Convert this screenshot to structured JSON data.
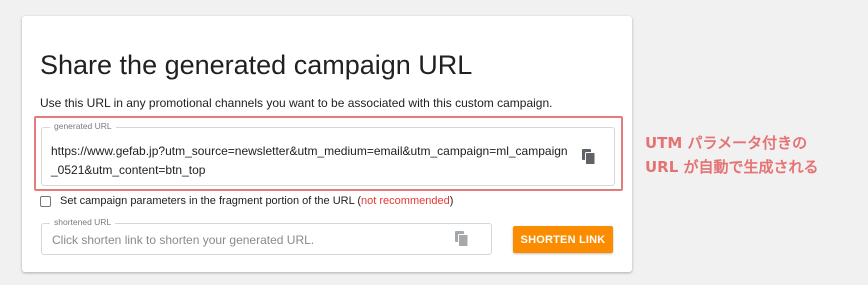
{
  "card": {
    "title": "Share the generated campaign URL",
    "description": "Use this URL in any promotional channels you want to be associated with this custom campaign."
  },
  "generated_url": {
    "label": "generated URL",
    "value": "https://www.gefab.jp?utm_source=newsletter&utm_medium=email&utm_campaign=ml_campaign_0521&utm_content=btn_top",
    "copy_icon": "copy-icon"
  },
  "fragment_option": {
    "checked": false,
    "label": "Set campaign parameters in the fragment portion of the URL (",
    "warning": "not recommended",
    "label_suffix": ")"
  },
  "shortened_url": {
    "label": "shortened URL",
    "placeholder": "Click shorten link to shorten your generated URL.",
    "copy_icon": "copy-icon"
  },
  "shorten_button": {
    "label": "SHORTEN LINK"
  },
  "annotation": {
    "line1": "UTM パラメータ付きの",
    "line2": "URL が自動で生成される"
  },
  "colors": {
    "accent_button": "#fb8c00",
    "annotation_red": "#e57373",
    "warning_red": "#e53935"
  }
}
